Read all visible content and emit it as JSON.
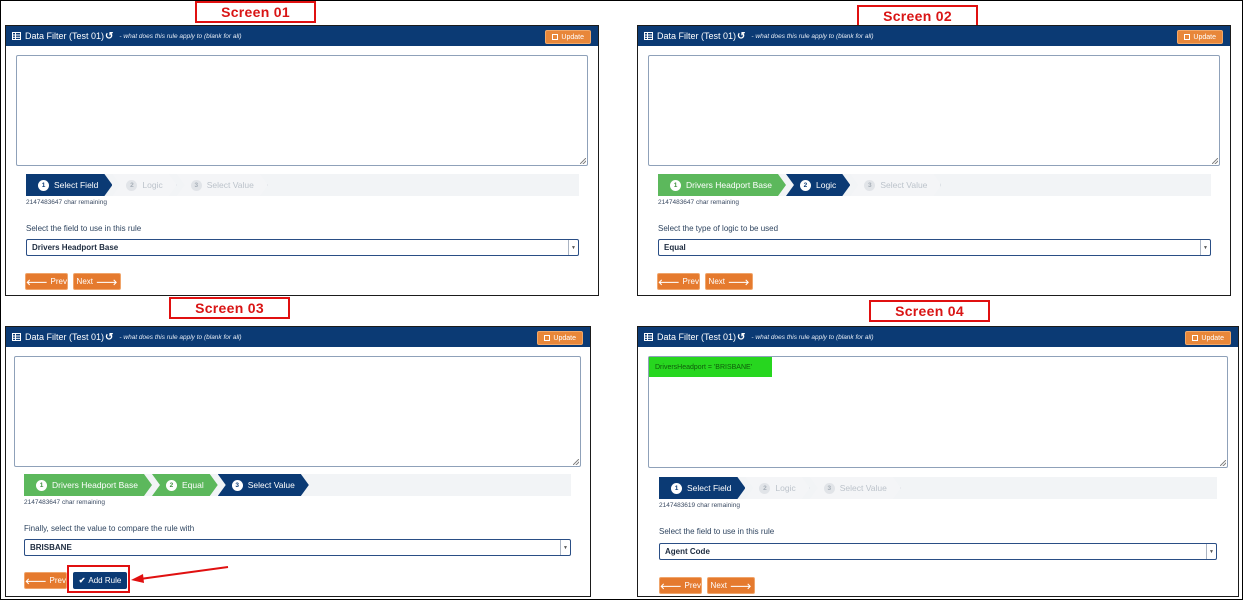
{
  "screen_labels": [
    "Screen 01",
    "Screen 02",
    "Screen 03",
    "Screen 04"
  ],
  "panel": {
    "title": "Data Filter (Test 01)",
    "reset_glyph": "↺",
    "hint": "- what does this rule apply to (blank for all)",
    "update_label": "Update"
  },
  "screens": [
    {
      "steps": [
        {
          "num": "1",
          "label": "Select Field",
          "state": "active"
        },
        {
          "num": "2",
          "label": "Logic",
          "state": "pending"
        },
        {
          "num": "3",
          "label": "Select Value",
          "state": "pending"
        }
      ],
      "chars_remaining": "2147483647 char remaining",
      "field_label": "Select the field to use in this rule",
      "select_value": "Drivers Headport Base",
      "buttons": {
        "prev": "Prev",
        "next": "Next"
      }
    },
    {
      "steps": [
        {
          "num": "1",
          "label": "Drivers Headport Base",
          "state": "done"
        },
        {
          "num": "2",
          "label": "Logic",
          "state": "active"
        },
        {
          "num": "3",
          "label": "Select Value",
          "state": "pending"
        }
      ],
      "chars_remaining": "2147483647 char remaining",
      "field_label": "Select the type of logic to be used",
      "select_value": "Equal",
      "buttons": {
        "prev": "Prev",
        "next": "Next"
      }
    },
    {
      "steps": [
        {
          "num": "1",
          "label": "Drivers Headport Base",
          "state": "done"
        },
        {
          "num": "2",
          "label": "Equal",
          "state": "done"
        },
        {
          "num": "3",
          "label": "Select Value",
          "state": "active"
        }
      ],
      "chars_remaining": "2147483647 char remaining",
      "field_label": "Finally, select the value to compare the rule with",
      "select_value": "BRISBANE",
      "buttons": {
        "prev": "Prev",
        "add_rule": "Add Rule"
      }
    },
    {
      "filter_expression": "DriversHeadport = 'BRISBANE'",
      "steps": [
        {
          "num": "1",
          "label": "Select Field",
          "state": "active"
        },
        {
          "num": "2",
          "label": "Logic",
          "state": "pending"
        },
        {
          "num": "3",
          "label": "Select Value",
          "state": "pending"
        }
      ],
      "chars_remaining": "2147483619 char remaining",
      "field_label": "Select the field to use in this rule",
      "select_value": "Agent Code",
      "buttons": {
        "prev": "Prev",
        "next": "Next"
      }
    }
  ],
  "colors": {
    "header": "#0b3a74",
    "update": "#e8873a",
    "step_done": "#5cb85c",
    "step_active": "#0b3a74",
    "annotation": "#e01010",
    "filter_tag": "#27d61f"
  }
}
